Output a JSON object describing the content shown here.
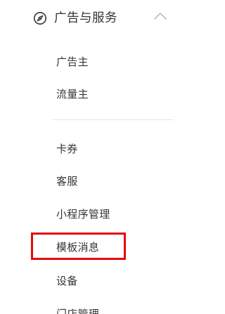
{
  "section": {
    "title": "广告与服务",
    "icon": "compass-icon",
    "collapse_icon": "chevron-up-icon",
    "expanded": true
  },
  "group1": [
    {
      "label": "广告主"
    },
    {
      "label": "流量主"
    }
  ],
  "group2": [
    {
      "label": "卡券"
    },
    {
      "label": "客服"
    },
    {
      "label": "小程序管理"
    },
    {
      "label": "模板消息"
    },
    {
      "label": "设备"
    },
    {
      "label": "门店管理"
    }
  ],
  "highlighted_item": "模板消息",
  "colors": {
    "text": "#353535",
    "divider": "#e6e6e6",
    "highlight": "#e40a0a",
    "icon": "#353535",
    "chevron": "#b2b2b2"
  }
}
